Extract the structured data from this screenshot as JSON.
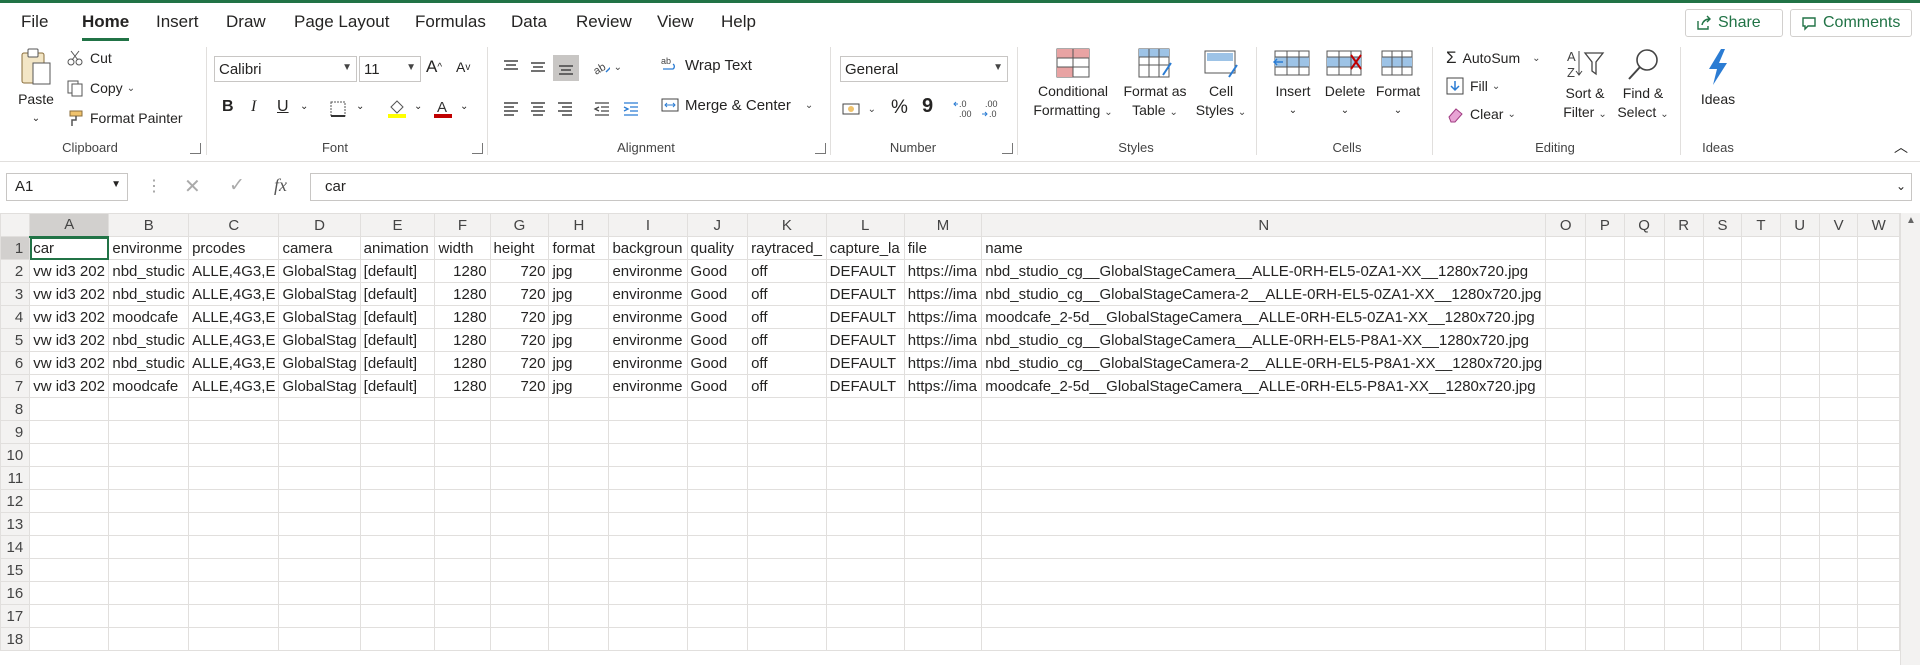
{
  "menu": {
    "tabs": [
      "File",
      "Home",
      "Insert",
      "Draw",
      "Page Layout",
      "Formulas",
      "Data",
      "Review",
      "View",
      "Help"
    ],
    "share": "Share",
    "comments": "Comments"
  },
  "ribbon": {
    "clipboard": {
      "paste": "Paste",
      "cut": "Cut",
      "copy": "Copy",
      "format_painter": "Format Painter",
      "label": "Clipboard"
    },
    "font": {
      "name": "Calibri",
      "size": "11",
      "label": "Font",
      "bold": "B",
      "italic": "I",
      "underline": "U"
    },
    "alignment": {
      "wrap": "Wrap Text",
      "merge": "Merge & Center",
      "label": "Alignment"
    },
    "number": {
      "format": "General",
      "label": "Number",
      "percent": "%",
      "comma": "9"
    },
    "styles": {
      "cond1": "Conditional",
      "cond2": "Formatting",
      "fmt1": "Format as",
      "fmt2": "Table",
      "cell1": "Cell",
      "cell2": "Styles",
      "label": "Styles"
    },
    "cells": {
      "insert": "Insert",
      "delete": "Delete",
      "format": "Format",
      "label": "Cells"
    },
    "editing": {
      "autosum": "AutoSum",
      "fill": "Fill",
      "clear": "Clear",
      "sort1": "Sort &",
      "sort2": "Filter",
      "find1": "Find &",
      "find2": "Select",
      "label": "Editing"
    },
    "ideas": {
      "ideas": "Ideas",
      "label": "Ideas"
    }
  },
  "formula_bar": {
    "name_box": "A1",
    "fx": "fx",
    "value": "car"
  },
  "sheet": {
    "columns": [
      "A",
      "B",
      "C",
      "D",
      "E",
      "F",
      "G",
      "H",
      "I",
      "J",
      "K",
      "L",
      "M",
      "N",
      "O",
      "P",
      "Q",
      "R",
      "S",
      "T",
      "U",
      "V",
      "W"
    ],
    "rows": [
      [
        "car",
        "environme",
        "prcodes",
        "camera",
        "animation",
        "width",
        "height",
        "format",
        "backgroun",
        "quality",
        "raytraced_",
        "capture_la",
        "file",
        "name"
      ],
      [
        "vw id3 202",
        "nbd_studic",
        "ALLE,4G3,E",
        "GlobalStag",
        "[default]",
        "1280",
        "720",
        "jpg",
        "environme",
        "Good",
        "off",
        "DEFAULT",
        "https://ima",
        "nbd_studio_cg__GlobalStageCamera__ALLE-0RH-EL5-0ZA1-XX__1280x720.jpg"
      ],
      [
        "vw id3 202",
        "nbd_studic",
        "ALLE,4G3,E",
        "GlobalStag",
        "[default]",
        "1280",
        "720",
        "jpg",
        "environme",
        "Good",
        "off",
        "DEFAULT",
        "https://ima",
        "nbd_studio_cg__GlobalStageCamera-2__ALLE-0RH-EL5-0ZA1-XX__1280x720.jpg"
      ],
      [
        "vw id3 202",
        "moodcafe",
        "ALLE,4G3,E",
        "GlobalStag",
        "[default]",
        "1280",
        "720",
        "jpg",
        "environme",
        "Good",
        "off",
        "DEFAULT",
        "https://ima",
        "moodcafe_2-5d__GlobalStageCamera__ALLE-0RH-EL5-0ZA1-XX__1280x720.jpg"
      ],
      [
        "vw id3 202",
        "nbd_studic",
        "ALLE,4G3,E",
        "GlobalStag",
        "[default]",
        "1280",
        "720",
        "jpg",
        "environme",
        "Good",
        "off",
        "DEFAULT",
        "https://ima",
        "nbd_studio_cg__GlobalStageCamera__ALLE-0RH-EL5-P8A1-XX__1280x720.jpg"
      ],
      [
        "vw id3 202",
        "nbd_studic",
        "ALLE,4G3,E",
        "GlobalStag",
        "[default]",
        "1280",
        "720",
        "jpg",
        "environme",
        "Good",
        "off",
        "DEFAULT",
        "https://ima",
        "nbd_studio_cg__GlobalStageCamera-2__ALLE-0RH-EL5-P8A1-XX__1280x720.jpg"
      ],
      [
        "vw id3 202",
        "moodcafe",
        "ALLE,4G3,E",
        "GlobalStag",
        "[default]",
        "1280",
        "720",
        "jpg",
        "environme",
        "Good",
        "off",
        "DEFAULT",
        "https://ima",
        "moodcafe_2-5d__GlobalStageCamera__ALLE-0RH-EL5-P8A1-XX__1280x720.jpg"
      ]
    ],
    "row_count": 18
  },
  "colors": {
    "accent": "#217346",
    "font_red": "#c00000",
    "highlight_yellow": "#ffff00",
    "icon_blue": "#2b7cd3"
  }
}
